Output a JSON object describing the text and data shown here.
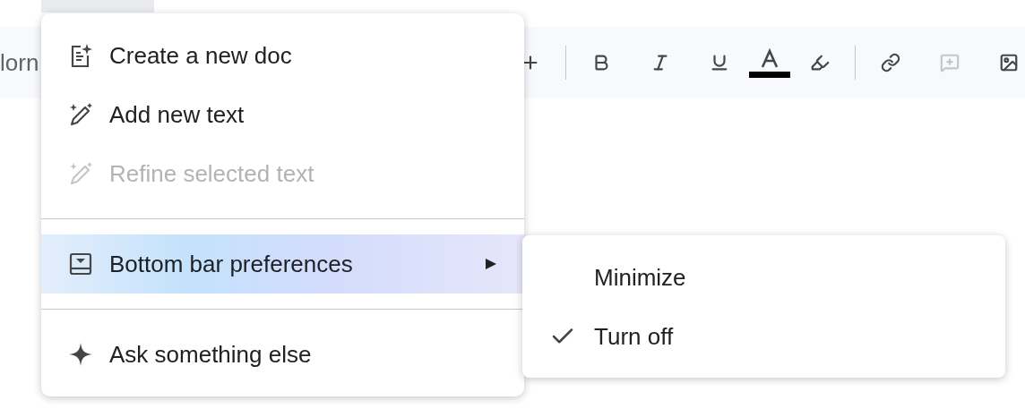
{
  "toolbar": {
    "font_style": "lorn",
    "buttons": [
      {
        "kind": "plus",
        "disabled": false
      },
      {
        "kind": "separator"
      },
      {
        "kind": "bold",
        "disabled": false
      },
      {
        "kind": "italic",
        "disabled": false
      },
      {
        "kind": "underline",
        "disabled": false
      },
      {
        "kind": "text-color",
        "disabled": false
      },
      {
        "kind": "highlight",
        "disabled": false
      },
      {
        "kind": "separator"
      },
      {
        "kind": "link",
        "disabled": false
      },
      {
        "kind": "comment",
        "disabled": true
      },
      {
        "kind": "image",
        "disabled": false
      }
    ]
  },
  "menu": {
    "items": [
      {
        "kind": "create-doc",
        "label": "Create a new doc",
        "disabled": false,
        "selected": false,
        "has_submenu": false
      },
      {
        "kind": "pen-sparkle",
        "label": "Add new text",
        "disabled": false,
        "selected": false,
        "has_submenu": false
      },
      {
        "kind": "pen-sparkle",
        "label": "Refine selected text",
        "disabled": true,
        "selected": false,
        "has_submenu": false
      },
      {
        "kind": "divider"
      },
      {
        "kind": "bottom-bar",
        "label": "Bottom bar preferences",
        "disabled": false,
        "selected": true,
        "has_submenu": true
      },
      {
        "kind": "divider"
      },
      {
        "kind": "sparkle",
        "label": "Ask something else",
        "disabled": false,
        "selected": false,
        "has_submenu": false
      }
    ]
  },
  "submenu": {
    "items": [
      {
        "label": "Minimize",
        "checked": false
      },
      {
        "label": "Turn off",
        "checked": true
      }
    ]
  }
}
